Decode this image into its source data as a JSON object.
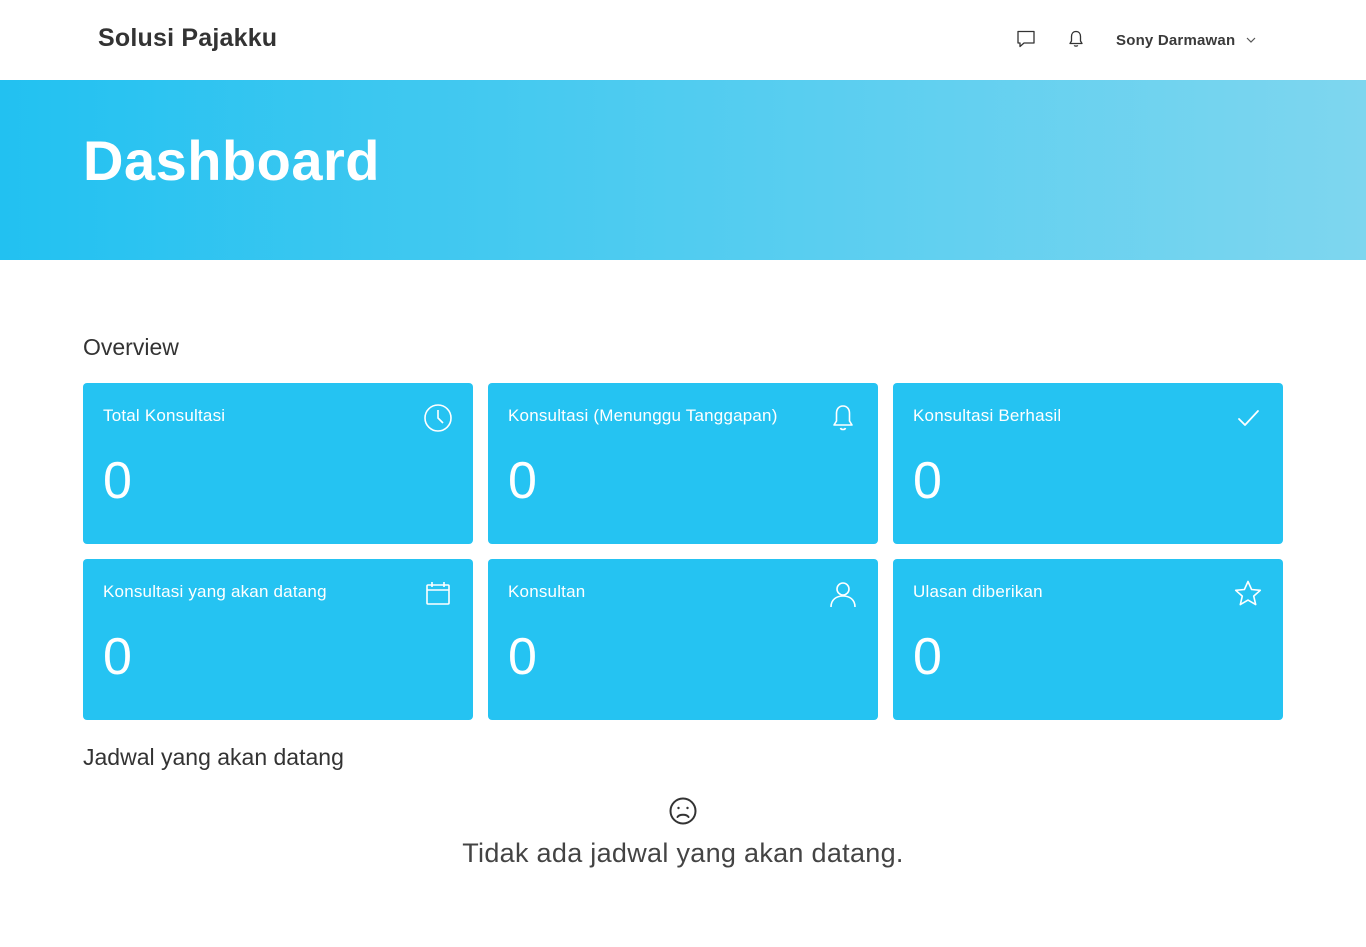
{
  "navbar": {
    "brand": "Solusi Pajakku",
    "icons": [
      "chat-icon",
      "bell-icon",
      "chevron-down-icon"
    ],
    "user_name": "Sony Darmawan"
  },
  "hero": {
    "title": "Dashboard"
  },
  "overview": {
    "title": "Overview",
    "cards": [
      {
        "label": "Total Konsultasi",
        "value": "0",
        "icon": "clock-icon"
      },
      {
        "label": "Konsultasi (Menunggu Tanggapan)",
        "value": "0",
        "icon": "bell-icon"
      },
      {
        "label": "Konsultasi Berhasil",
        "value": "0",
        "icon": "check-icon"
      },
      {
        "label": "Konsultasi yang akan datang",
        "value": "0",
        "icon": "calendar-icon"
      },
      {
        "label": "Konsultan",
        "value": "0",
        "icon": "user-icon"
      },
      {
        "label": "Ulasan diberikan",
        "value": "0",
        "icon": "star-icon"
      }
    ]
  },
  "schedule": {
    "title": "Jadwal yang akan datang",
    "empty_icon": "sad-face-icon",
    "empty_text": "Tidak ada jadwal yang akan datang."
  },
  "colors": {
    "accent": "#25c3f2",
    "hero_gradient_start": "#22c1f1",
    "hero_gradient_end": "#7ed6ef",
    "text": "#333333"
  }
}
